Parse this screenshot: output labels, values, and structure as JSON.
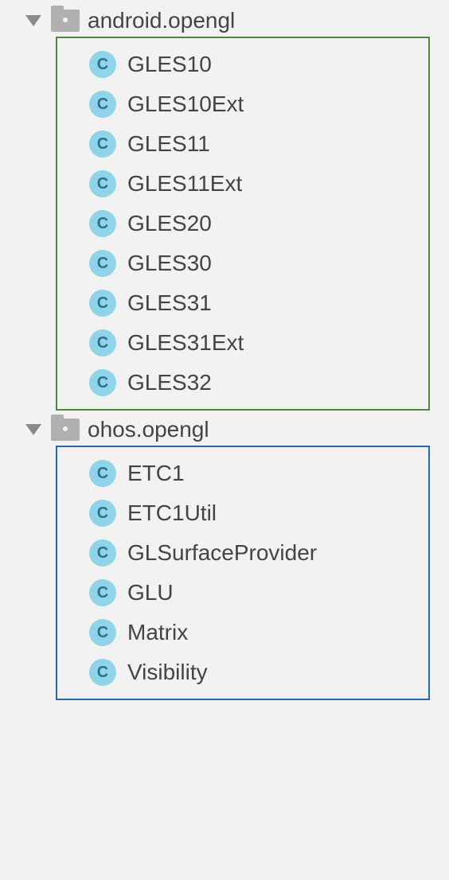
{
  "packages": [
    {
      "name": "android.opengl",
      "boxColor": "green",
      "classes": [
        "GLES10",
        "GLES10Ext",
        "GLES11",
        "GLES11Ext",
        "GLES20",
        "GLES30",
        "GLES31",
        "GLES31Ext",
        "GLES32"
      ]
    },
    {
      "name": "ohos.opengl",
      "boxColor": "blue",
      "classes": [
        "ETC1",
        "ETC1Util",
        "GLSurfaceProvider",
        "GLU",
        "Matrix",
        "Visibility"
      ]
    }
  ],
  "iconLetter": "C"
}
